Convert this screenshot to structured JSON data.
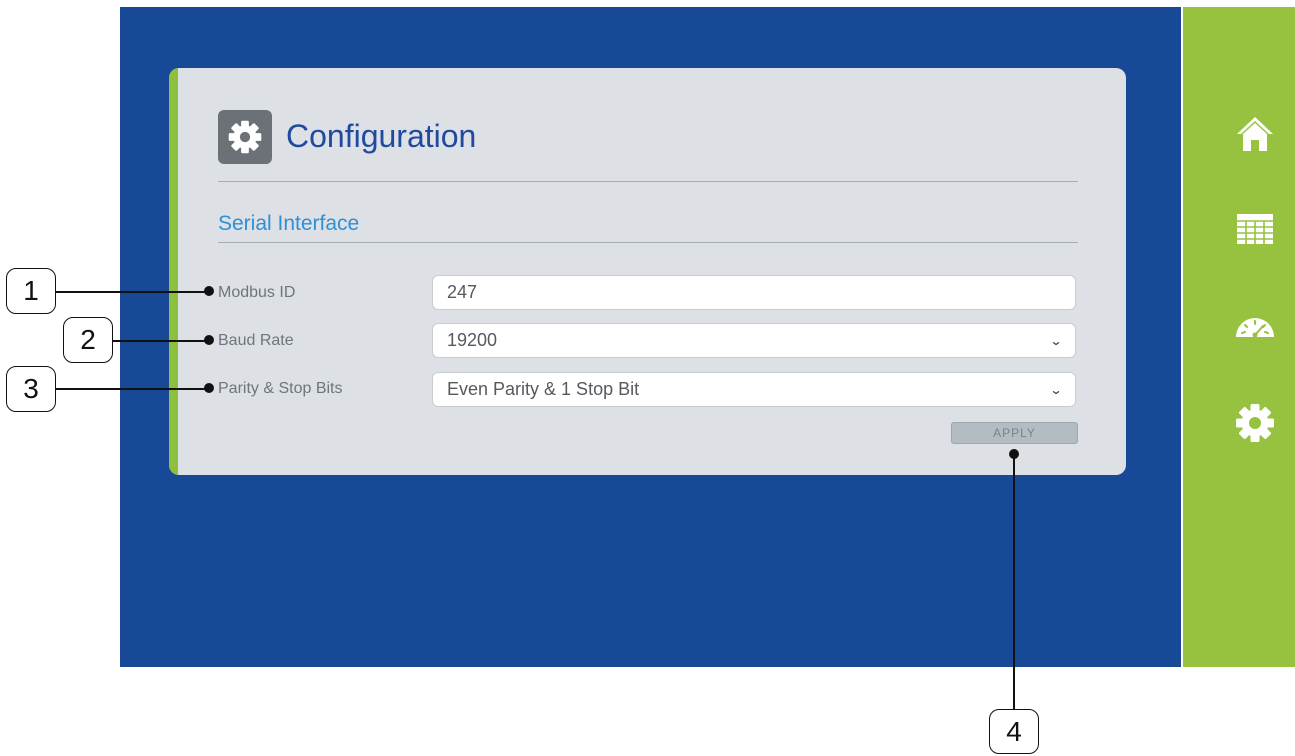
{
  "page": {
    "title": "Configuration",
    "section": "Serial Interface"
  },
  "form": {
    "modbus_id": {
      "label": "Modbus ID",
      "value": "247"
    },
    "baud_rate": {
      "label": "Baud Rate",
      "value": "19200"
    },
    "parity": {
      "label": "Parity & Stop Bits",
      "value": "Even Parity & 1 Stop Bit"
    },
    "apply_label": "APPLY"
  },
  "sidebar": {
    "items": [
      {
        "icon": "home-icon"
      },
      {
        "icon": "table-icon"
      },
      {
        "icon": "gauge-icon"
      },
      {
        "icon": "gear-icon"
      }
    ]
  },
  "callouts": [
    "1",
    "2",
    "3",
    "4"
  ],
  "colors": {
    "screen_background": "#184996",
    "sidebar_background": "#96c23f",
    "card_background": "#dde1e5",
    "title_text": "#1f4aa0",
    "section_text": "#2f8fd6"
  }
}
